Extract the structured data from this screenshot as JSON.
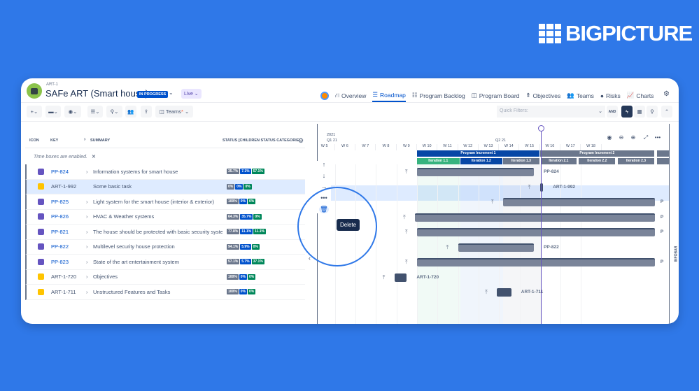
{
  "brand": {
    "logo_text": "BIGPICTURE"
  },
  "header": {
    "breadcrumb": "ART-1",
    "title": "SAFe ART (Smart house)",
    "status": "IN PROGRESS",
    "mode": "Live"
  },
  "nav": [
    {
      "label": "Overview",
      "icon": "hierarchy-icon"
    },
    {
      "label": "Roadmap",
      "icon": "roadmap-icon",
      "active": true
    },
    {
      "label": "Program Backlog",
      "icon": "list-icon"
    },
    {
      "label": "Program Board",
      "icon": "board-icon"
    },
    {
      "label": "Objectives",
      "icon": "signpost-icon"
    },
    {
      "label": "Teams",
      "icon": "people-icon"
    },
    {
      "label": "Risks",
      "icon": "bomb-icon"
    },
    {
      "label": "Charts",
      "icon": "chart-icon"
    }
  ],
  "toolbar": {
    "teams_label": "Teams",
    "quick_filters_placeholder": "Quick Filters:",
    "and_label": "AND"
  },
  "table": {
    "headers": {
      "icon": "ICON",
      "key": "KEY",
      "summary": "SUMMARY",
      "status": "STATUS [CHILDREN STATUS CATEGORIE"
    },
    "timebox_notice": "Time boxes are enabled.",
    "rows": [
      {
        "type": "epic",
        "key": "PP-824",
        "summary": "Information systems for smart house",
        "status": [
          "35.7%",
          "7.1%",
          "57.1%"
        ],
        "chev": true
      },
      {
        "type": "task",
        "key": "ART-1-992",
        "summary": "Some basic task",
        "status": [
          "0%",
          "0%",
          "0%"
        ],
        "chev": false,
        "selected": true
      },
      {
        "type": "epic",
        "key": "PP-825",
        "summary": "Light system for the smart house (interior & exterior)",
        "status": [
          "100%",
          "0%",
          "0%"
        ],
        "chev": true
      },
      {
        "type": "epic",
        "key": "PP-826",
        "summary": "HVAC & Weather systems",
        "status": [
          "64.3%",
          "35.7%",
          "0%"
        ],
        "chev": true
      },
      {
        "type": "epic",
        "key": "PP-821",
        "summary": "The house should be protected with basic security systems",
        "status": [
          "77.8%",
          "11.1%",
          "11.1%"
        ],
        "chev": true
      },
      {
        "type": "epic",
        "key": "PP-822",
        "summary": "Multilevel security house protection",
        "status": [
          "94.1%",
          "5.9%",
          "0%"
        ],
        "chev": true
      },
      {
        "type": "epic",
        "key": "PP-823",
        "summary": "State of the art entertainment system",
        "status": [
          "57.1%",
          "5.7%",
          "37.1%"
        ],
        "chev": true
      },
      {
        "type": "task",
        "key": "ART-1-720",
        "summary": "Objectives",
        "status": [
          "100%",
          "0%",
          "0%"
        ],
        "chev": true
      },
      {
        "type": "task",
        "key": "ART-1-711",
        "summary": "Unstructured Features and Tasks",
        "status": [
          "100%",
          "0%",
          "0%"
        ],
        "chev": true
      }
    ]
  },
  "timeline": {
    "year": "2021",
    "q1": "Q1 21",
    "q2": "Q2 21",
    "weeks": [
      "W 5",
      "W 6",
      "W 7",
      "W 8",
      "W 9",
      "W 10",
      "W 11",
      "W 12",
      "W 13",
      "W 14",
      "W 15",
      "W 16",
      "W 17",
      "W 18"
    ],
    "today_week": 16.04,
    "increments": [
      {
        "label": "Program Increment 1",
        "start": 10,
        "end": 16,
        "color": "#0747a6"
      },
      {
        "label": "Program Increment 2",
        "start": 16,
        "end": 21.6,
        "color": "#6b778c"
      }
    ],
    "iterations": [
      {
        "label": "Iteration 1.1",
        "start": 10,
        "end": 12.1,
        "color": "#36b37e"
      },
      {
        "label": "Iteration 1.2",
        "start": 12.1,
        "end": 14.2,
        "color": "#0747a6"
      },
      {
        "label": "Iteration 1.3",
        "start": 14.2,
        "end": 16,
        "color": "#6b778c"
      },
      {
        "label": "Iteration 2.1",
        "start": 16.05,
        "end": 17.8,
        "color": "#6b778c"
      },
      {
        "label": "Iteration 2.2",
        "start": 17.9,
        "end": 19.7,
        "color": "#6b778c"
      },
      {
        "label": "Iteration 2.3",
        "start": 19.8,
        "end": 21.6,
        "color": "#6b778c"
      }
    ],
    "bars": [
      {
        "key": "PP-824",
        "start": 10.0,
        "end": 15.7,
        "label": true
      },
      {
        "key": "ART-1-992",
        "start": 16.0,
        "end": 16.15,
        "label": true
      },
      {
        "key": "PP-825",
        "start": 14.2,
        "end": 21.6
      },
      {
        "key": "PP-826",
        "start": 9.9,
        "end": 21.6
      },
      {
        "key": "PP-821",
        "start": 10.0,
        "end": 21.6
      },
      {
        "key": "PP-822",
        "start": 12.0,
        "end": 15.7,
        "label": true
      },
      {
        "key": "PP-823",
        "start": 10.0,
        "end": 21.6
      },
      {
        "key": "ART-1-720",
        "start": 8.9,
        "end": 9.5,
        "label": true
      },
      {
        "key": "ART-1-711",
        "start": 13.9,
        "end": 14.6,
        "label": true
      }
    ]
  },
  "context_menu": {
    "tooltip": "Delete"
  },
  "infobar": "INFOBAR",
  "colors": {
    "epic": "#6554c0",
    "task": "#ffc400",
    "todo": "#6b778c",
    "inprogress": "#0052cc",
    "done": "#00875a"
  }
}
